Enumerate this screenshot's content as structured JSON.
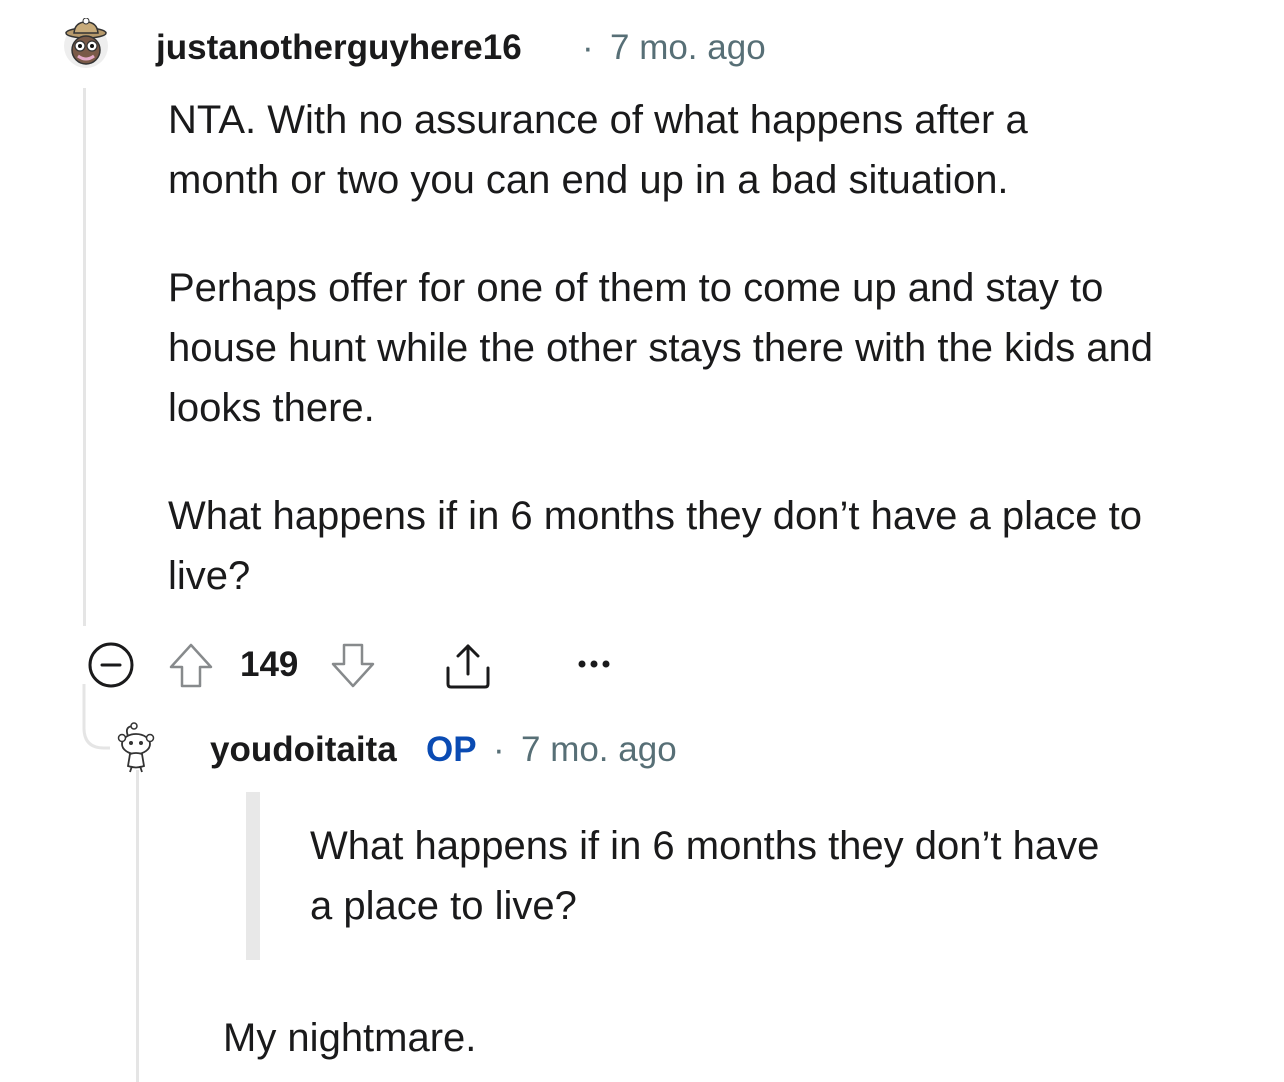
{
  "comment": {
    "username": "justanotherguyhere16",
    "separator": "·",
    "timestamp": "7 mo. ago",
    "paragraphs": [
      "NTA. With no assurance of what happens after a month or two you can end up in a bad situation.",
      "Perhaps offer for one of them to come up and stay to house hunt while the other stays there with the kids and looks there.",
      "What happens if in 6 months they don’t have a place to live?"
    ],
    "actions": {
      "collapse_icon": "minus-circle-icon",
      "upvote_icon": "arrow-up-outline-icon",
      "vote_count": "149",
      "downvote_icon": "arrow-down-outline-icon",
      "share_icon": "share-upload-icon",
      "more_icon": "ellipsis-icon"
    }
  },
  "reply": {
    "username": "youdoitaita",
    "op_label": "OP",
    "separator": "·",
    "timestamp": "7 mo. ago",
    "quote": "What happens if in 6 months they don’t have a place to live?",
    "text": "My nightmare."
  },
  "colors": {
    "meta": "#576f76",
    "op": "#0a4bb3",
    "thread_line": "#e5e5e5",
    "icon": "#1a1a1b"
  }
}
